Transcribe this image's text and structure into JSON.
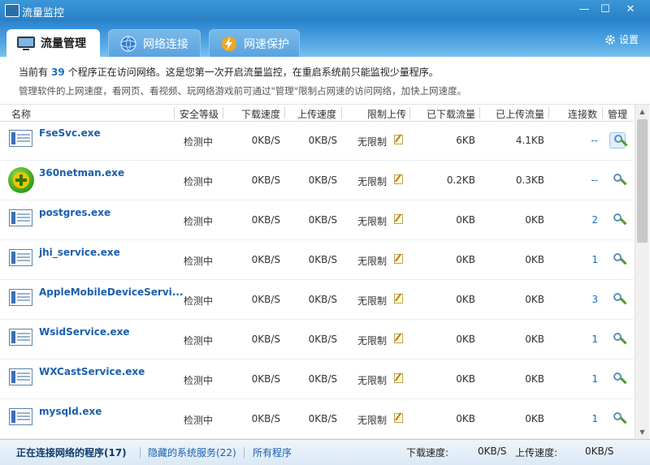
{
  "window": {
    "title": "流量监控",
    "buttons": {
      "min": "—",
      "max": "☐",
      "close": "✕"
    }
  },
  "tabs": [
    {
      "label": "流量管理",
      "active": true
    },
    {
      "label": "网络连接",
      "active": false
    },
    {
      "label": "网速保护",
      "active": false
    }
  ],
  "settings_label": "设置",
  "info": {
    "line1_prefix": "当前有",
    "count": "39",
    "line1_suffix": "个程序正在访问网络。这是您第一次开启流量监控，在重启系统前只能监视少量程序。",
    "line2": "管理软件的上网速度，看网页、看视频、玩网络游戏前可通过\"管理\"限制占网速的访问网络，加快上网速度。"
  },
  "columns": [
    "名称",
    "安全等级",
    "下载速度",
    "上传速度",
    "限制上传",
    "已下载流量",
    "已上传流量",
    "连接数",
    "管理"
  ],
  "rows": [
    {
      "name": "FseSvc.exe",
      "icon": "window-app-icon",
      "security": "检测中",
      "down": "0KB/S",
      "up": "0KB/S",
      "limit": "无限制",
      "downloaded": "6KB",
      "uploaded": "4.1KB",
      "connections": "--"
    },
    {
      "name": "360netman.exe",
      "icon": "360-plus-icon",
      "security": "检测中",
      "down": "0KB/S",
      "up": "0KB/S",
      "limit": "无限制",
      "downloaded": "0.2KB",
      "uploaded": "0.3KB",
      "connections": "--"
    },
    {
      "name": "postgres.exe",
      "icon": "window-app-icon",
      "security": "检测中",
      "down": "0KB/S",
      "up": "0KB/S",
      "limit": "无限制",
      "downloaded": "0KB",
      "uploaded": "0KB",
      "connections": "2"
    },
    {
      "name": "jhi_service.exe",
      "icon": "window-app-icon",
      "security": "检测中",
      "down": "0KB/S",
      "up": "0KB/S",
      "limit": "无限制",
      "downloaded": "0KB",
      "uploaded": "0KB",
      "connections": "1"
    },
    {
      "name": "AppleMobileDeviceServi...",
      "icon": "window-app-icon",
      "security": "检测中",
      "down": "0KB/S",
      "up": "0KB/S",
      "limit": "无限制",
      "downloaded": "0KB",
      "uploaded": "0KB",
      "connections": "3"
    },
    {
      "name": "WsidService.exe",
      "icon": "window-app-icon",
      "security": "检测中",
      "down": "0KB/S",
      "up": "0KB/S",
      "limit": "无限制",
      "downloaded": "0KB",
      "uploaded": "0KB",
      "connections": "1"
    },
    {
      "name": "WXCastService.exe",
      "icon": "window-app-icon",
      "security": "检测中",
      "down": "0KB/S",
      "up": "0KB/S",
      "limit": "无限制",
      "downloaded": "0KB",
      "uploaded": "0KB",
      "connections": "1"
    },
    {
      "name": "mysqld.exe",
      "icon": "window-app-icon",
      "security": "检测中",
      "down": "0KB/S",
      "up": "0KB/S",
      "limit": "无限制",
      "downloaded": "0KB",
      "uploaded": "0KB",
      "connections": "1"
    }
  ],
  "footer": {
    "connected": "正在连接网络的程序(17)",
    "hidden": "隐藏的系统服务(22)",
    "all": "所有程序",
    "download_label": "下载速度:",
    "download_value": "0KB/S",
    "upload_label": "上传速度:",
    "upload_value": "0KB/S"
  },
  "colors": {
    "accent": "#1a6fc0",
    "titlebar": "#2a7fc4",
    "link": "#1a5fae"
  }
}
